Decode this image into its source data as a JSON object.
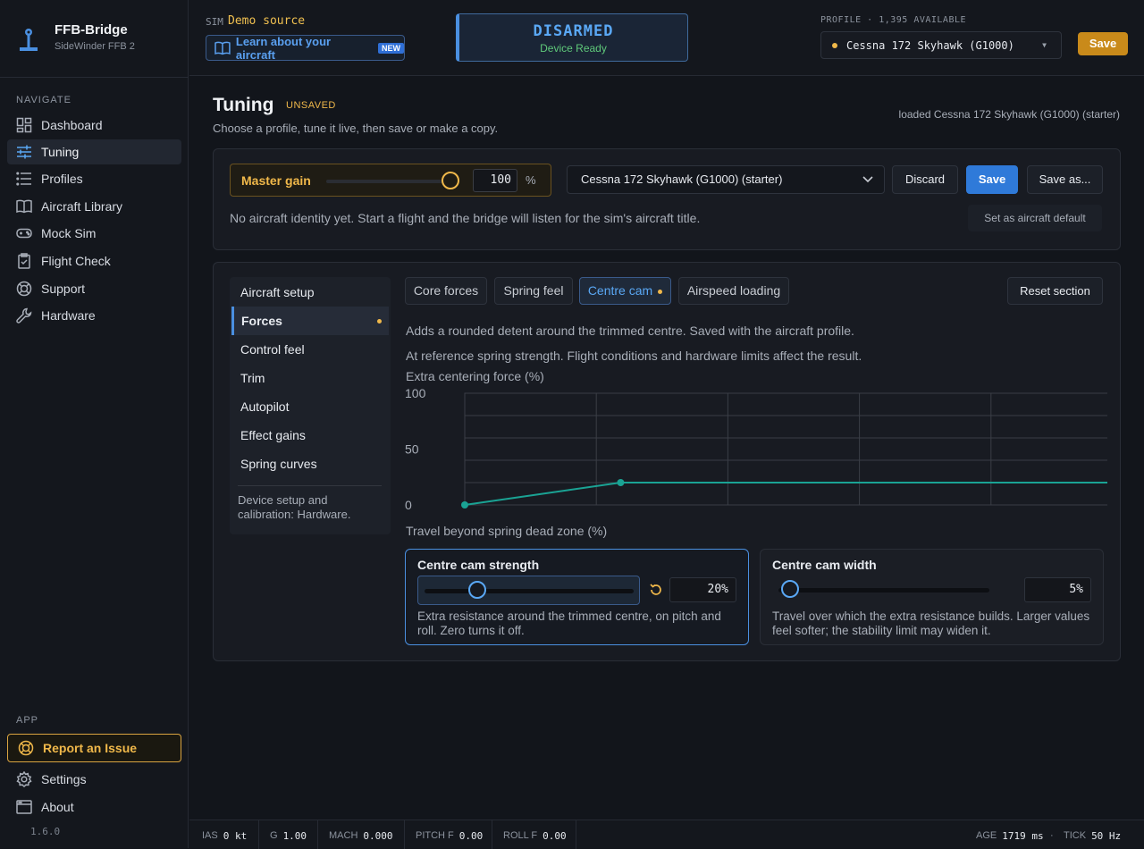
{
  "app": {
    "title": "FFB-Bridge",
    "subtitle": "SideWinder FFB 2",
    "version": "1.6.0"
  },
  "sidebar": {
    "navigate_label": "NAVIGATE",
    "items": [
      {
        "label": "Dashboard",
        "icon": "dashboard-icon"
      },
      {
        "label": "Tuning",
        "icon": "sliders-icon",
        "active": true
      },
      {
        "label": "Profiles",
        "icon": "list-icon"
      },
      {
        "label": "Aircraft Library",
        "icon": "book-icon"
      },
      {
        "label": "Mock Sim",
        "icon": "gamepad-icon"
      },
      {
        "label": "Flight Check",
        "icon": "clipboard-icon"
      },
      {
        "label": "Support",
        "icon": "lifebuoy-icon"
      },
      {
        "label": "Hardware",
        "icon": "wrench-icon"
      }
    ],
    "app_label": "APP",
    "report_label": "Report an Issue",
    "settings_label": "Settings",
    "about_label": "About"
  },
  "topbar": {
    "sim_label": "SIM",
    "sim_value": "Demo source",
    "learn_label": "Learn about your aircraft",
    "new_badge": "NEW",
    "armed_title": "DISARMED",
    "armed_sub": "Device Ready",
    "profile_label": "PROFILE · 1,395 AVAILABLE",
    "profile_value": "Cessna 172 Skyhawk (G1000)",
    "save_label": "Save"
  },
  "page": {
    "title": "Tuning",
    "unsaved": "UNSAVED",
    "subtitle": "Choose a profile, tune it live, then save or make a copy.",
    "loaded": "loaded Cessna 172 Skyhawk (G1000) (starter)"
  },
  "gain": {
    "label": "Master gain",
    "value": "100",
    "unit": "%",
    "fraction": 1.0,
    "profile_select": "Cessna 172 Skyhawk (G1000) (starter)",
    "discard": "Discard",
    "save": "Save",
    "save_as": "Save as...",
    "identity": "No aircraft identity yet. Start a flight and the bridge will listen for the sim's aircraft title.",
    "set_default": "Set as aircraft default"
  },
  "sections": {
    "items": [
      {
        "label": "Aircraft setup"
      },
      {
        "label": "Forces",
        "active": true,
        "modified": true
      },
      {
        "label": "Control feel"
      },
      {
        "label": "Trim"
      },
      {
        "label": "Autopilot"
      },
      {
        "label": "Effect gains"
      },
      {
        "label": "Spring curves"
      }
    ],
    "note": "Device setup and calibration: Hardware."
  },
  "tabs": {
    "items": [
      {
        "label": "Core forces"
      },
      {
        "label": "Spring feel"
      },
      {
        "label": "Centre cam",
        "active": true,
        "modified": true
      },
      {
        "label": "Airspeed loading"
      }
    ],
    "reset": "Reset section"
  },
  "content": {
    "desc1": "Adds a rounded detent around the trimmed centre. Saved with the aircraft profile.",
    "desc2": "At reference spring strength. Flight conditions and hardware limits affect the result."
  },
  "chart_data": {
    "type": "line",
    "ylabel": "Extra centering force (%)",
    "xlabel": "Travel beyond spring dead zone (%)",
    "ylim": [
      0,
      100
    ],
    "xlim": [
      0,
      100
    ],
    "yticks": [
      "100",
      "50",
      "0"
    ],
    "grid": true,
    "series": [
      {
        "x": [
          0,
          23.7,
          100
        ],
        "y": [
          0,
          20,
          20
        ],
        "color": "#1aa394"
      }
    ]
  },
  "cam_strength": {
    "title": "Centre cam strength",
    "value": "20%",
    "fraction": 0.2,
    "desc": "Extra resistance around the trimmed centre, on pitch and roll. Zero turns it off."
  },
  "cam_width": {
    "title": "Centre cam width",
    "value": "5%",
    "fraction": 0.05,
    "desc": "Travel over which the extra resistance builds. Larger values feel softer; the stability limit may widen it."
  },
  "status": {
    "ias_label": "IAS",
    "ias": "0 kt",
    "g_label": "G",
    "g": "1.00",
    "mach_label": "MACH",
    "mach": "0.000",
    "pitch_label": "PITCH F",
    "pitch": "0.00",
    "roll_label": "ROLL F",
    "roll": "0.00",
    "age_label": "AGE",
    "age": "1719 ms",
    "tick_label": "TICK",
    "tick": "50 Hz"
  }
}
